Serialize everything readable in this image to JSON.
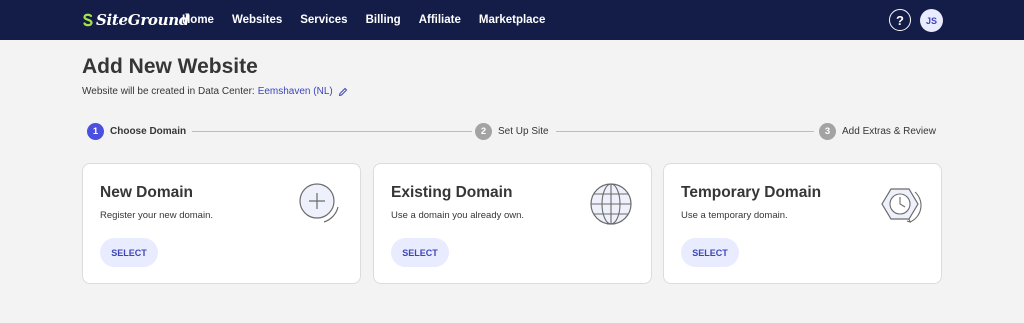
{
  "brand": {
    "name": "SiteGround"
  },
  "nav": [
    {
      "label": "Home"
    },
    {
      "label": "Websites"
    },
    {
      "label": "Services"
    },
    {
      "label": "Billing"
    },
    {
      "label": "Affiliate"
    },
    {
      "label": "Marketplace"
    }
  ],
  "header": {
    "help_label": "?",
    "avatar_initials": "JS"
  },
  "page": {
    "title": "Add New Website",
    "subtitle_prefix": "Website will be created in Data Center:",
    "data_center": "Eemshaven (NL)"
  },
  "steps": [
    {
      "num": "1",
      "label": "Choose Domain",
      "state": "active"
    },
    {
      "num": "2",
      "label": "Set Up Site",
      "state": "inactive"
    },
    {
      "num": "3",
      "label": "Add Extras & Review",
      "state": "inactive"
    }
  ],
  "cards": [
    {
      "title": "New Domain",
      "desc": "Register your new domain.",
      "button": "SELECT",
      "icon": "plus-circle-icon"
    },
    {
      "title": "Existing Domain",
      "desc": "Use a domain you already own.",
      "button": "SELECT",
      "icon": "globe-icon"
    },
    {
      "title": "Temporary Domain",
      "desc": "Use a temporary domain.",
      "button": "SELECT",
      "icon": "clock-hexagon-icon"
    }
  ],
  "colors": {
    "topbar": "#131d47",
    "accent": "#3d45b8",
    "step_active": "#4a4fe0",
    "step_inactive": "#a3a3a3",
    "button_bg": "#e9ebff"
  }
}
